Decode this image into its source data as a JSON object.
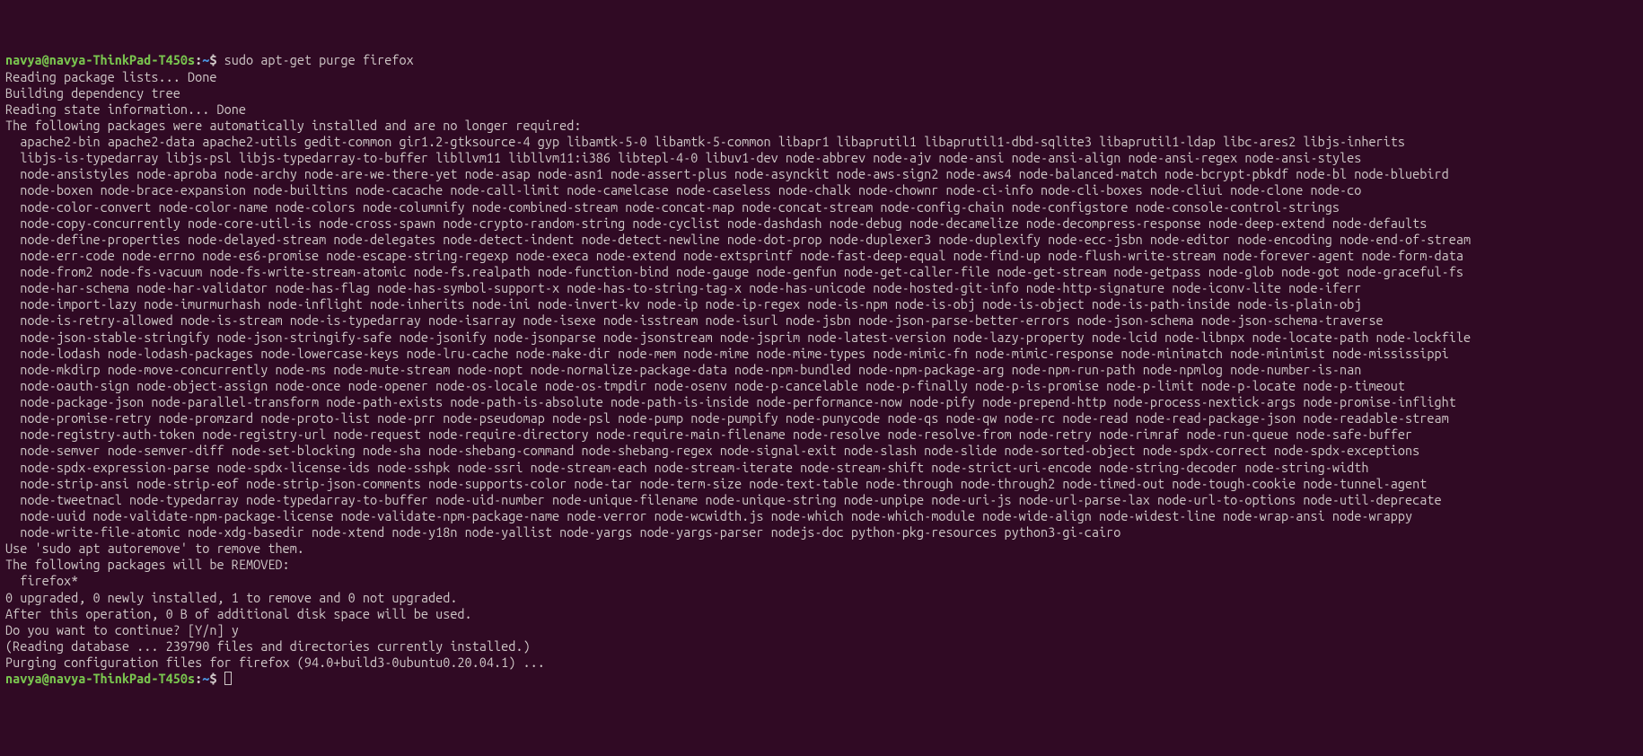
{
  "prompt1": {
    "userhost": "navya@navya-ThinkPad-T450s",
    "colon": ":",
    "path": "~",
    "dollar": "$",
    "command": "sudo apt-get purge firefox"
  },
  "lines": [
    "Reading package lists... Done",
    "Building dependency tree",
    "Reading state information... Done",
    "The following packages were automatically installed and are no longer required:",
    "  apache2-bin apache2-data apache2-utils gedit-common gir1.2-gtksource-4 gyp libamtk-5-0 libamtk-5-common libapr1 libaprutil1 libaprutil1-dbd-sqlite3 libaprutil1-ldap libc-ares2 libjs-inherits",
    "  libjs-is-typedarray libjs-psl libjs-typedarray-to-buffer libllvm11 libllvm11:i386 libtepl-4-0 libuv1-dev node-abbrev node-ajv node-ansi node-ansi-align node-ansi-regex node-ansi-styles",
    "  node-ansistyles node-aproba node-archy node-are-we-there-yet node-asap node-asn1 node-assert-plus node-asynckit node-aws-sign2 node-aws4 node-balanced-match node-bcrypt-pbkdf node-bl node-bluebird",
    "  node-boxen node-brace-expansion node-builtins node-cacache node-call-limit node-camelcase node-caseless node-chalk node-chownr node-ci-info node-cli-boxes node-cliui node-clone node-co",
    "  node-color-convert node-color-name node-colors node-columnify node-combined-stream node-concat-map node-concat-stream node-config-chain node-configstore node-console-control-strings",
    "  node-copy-concurrently node-core-util-is node-cross-spawn node-crypto-random-string node-cyclist node-dashdash node-debug node-decamelize node-decompress-response node-deep-extend node-defaults",
    "  node-define-properties node-delayed-stream node-delegates node-detect-indent node-detect-newline node-dot-prop node-duplexer3 node-duplexify node-ecc-jsbn node-editor node-encoding node-end-of-stream",
    "  node-err-code node-errno node-es6-promise node-escape-string-regexp node-execa node-extend node-extsprintf node-fast-deep-equal node-find-up node-flush-write-stream node-forever-agent node-form-data",
    "  node-from2 node-fs-vacuum node-fs-write-stream-atomic node-fs.realpath node-function-bind node-gauge node-genfun node-get-caller-file node-get-stream node-getpass node-glob node-got node-graceful-fs",
    "  node-har-schema node-har-validator node-has-flag node-has-symbol-support-x node-has-to-string-tag-x node-has-unicode node-hosted-git-info node-http-signature node-iconv-lite node-iferr",
    "  node-import-lazy node-imurmurhash node-inflight node-inherits node-ini node-invert-kv node-ip node-ip-regex node-is-npm node-is-obj node-is-object node-is-path-inside node-is-plain-obj",
    "  node-is-retry-allowed node-is-stream node-is-typedarray node-isarray node-isexe node-isstream node-isurl node-jsbn node-json-parse-better-errors node-json-schema node-json-schema-traverse",
    "  node-json-stable-stringify node-json-stringify-safe node-jsonify node-jsonparse node-jsonstream node-jsprim node-latest-version node-lazy-property node-lcid node-libnpx node-locate-path node-lockfile",
    "  node-lodash node-lodash-packages node-lowercase-keys node-lru-cache node-make-dir node-mem node-mime node-mime-types node-mimic-fn node-mimic-response node-minimatch node-minimist node-mississippi",
    "  node-mkdirp node-move-concurrently node-ms node-mute-stream node-nopt node-normalize-package-data node-npm-bundled node-npm-package-arg node-npm-run-path node-npmlog node-number-is-nan",
    "  node-oauth-sign node-object-assign node-once node-opener node-os-locale node-os-tmpdir node-osenv node-p-cancelable node-p-finally node-p-is-promise node-p-limit node-p-locate node-p-timeout",
    "  node-package-json node-parallel-transform node-path-exists node-path-is-absolute node-path-is-inside node-performance-now node-pify node-prepend-http node-process-nextick-args node-promise-inflight",
    "  node-promise-retry node-promzard node-proto-list node-prr node-pseudomap node-psl node-pump node-pumpify node-punycode node-qs node-qw node-rc node-read node-read-package-json node-readable-stream",
    "  node-registry-auth-token node-registry-url node-request node-require-directory node-require-main-filename node-resolve node-resolve-from node-retry node-rimraf node-run-queue node-safe-buffer",
    "  node-semver node-semver-diff node-set-blocking node-sha node-shebang-command node-shebang-regex node-signal-exit node-slash node-slide node-sorted-object node-spdx-correct node-spdx-exceptions",
    "  node-spdx-expression-parse node-spdx-license-ids node-sshpk node-ssri node-stream-each node-stream-iterate node-stream-shift node-strict-uri-encode node-string-decoder node-string-width",
    "  node-strip-ansi node-strip-eof node-strip-json-comments node-supports-color node-tar node-term-size node-text-table node-through node-through2 node-timed-out node-tough-cookie node-tunnel-agent",
    "  node-tweetnacl node-typedarray node-typedarray-to-buffer node-uid-number node-unique-filename node-unique-string node-unpipe node-uri-js node-url-parse-lax node-url-to-options node-util-deprecate",
    "  node-uuid node-validate-npm-package-license node-validate-npm-package-name node-verror node-wcwidth.js node-which node-which-module node-wide-align node-widest-line node-wrap-ansi node-wrappy",
    "  node-write-file-atomic node-xdg-basedir node-xtend node-y18n node-yallist node-yargs node-yargs-parser nodejs-doc python-pkg-resources python3-gi-cairo",
    "Use 'sudo apt autoremove' to remove them.",
    "The following packages will be REMOVED:",
    "  firefox*",
    "0 upgraded, 0 newly installed, 1 to remove and 0 not upgraded.",
    "After this operation, 0 B of additional disk space will be used.",
    "Do you want to continue? [Y/n] y",
    "(Reading database ... 239790 files and directories currently installed.)",
    "Purging configuration files for firefox (94.0+build3-0ubuntu0.20.04.1) ..."
  ],
  "prompt2": {
    "userhost": "navya@navya-ThinkPad-T450s",
    "colon": ":",
    "path": "~",
    "dollar": "$"
  }
}
